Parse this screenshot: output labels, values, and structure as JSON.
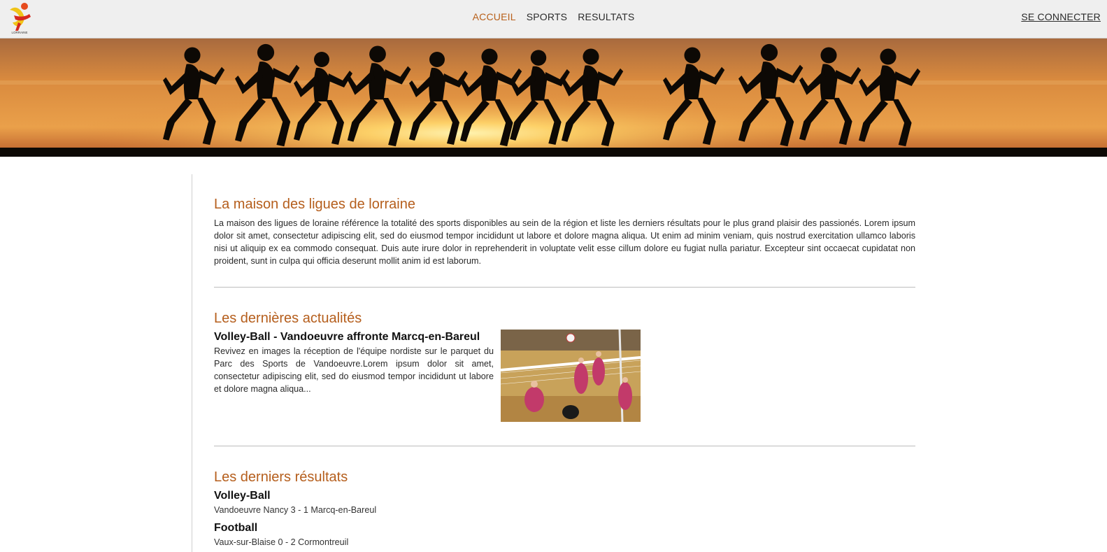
{
  "header": {
    "logo_caption": "LORRAINE",
    "nav": [
      {
        "label": "ACCUEIL",
        "active": true
      },
      {
        "label": "SPORTS",
        "active": false
      },
      {
        "label": "RESULTATS",
        "active": false
      }
    ],
    "login_label": "SE CONNECTER"
  },
  "colors": {
    "accent": "#b55e1c",
    "nav_bg": "#efefef",
    "banner_sky_top": "#c87a3a",
    "banner_sky_glow": "#f2b451"
  },
  "intro": {
    "title": "La maison des ligues de lorraine",
    "text": "La maison des ligues de loraine référence la totalité des sports disponibles au sein de la région et liste les derniers résultats pour le plus grand plaisir des passionés. Lorem ipsum dolor sit amet, consectetur adipiscing elit, sed do eiusmod tempor incididunt ut labore et dolore magna aliqua. Ut enim ad minim veniam, quis nostrud exercitation ullamco laboris nisi ut aliquip ex ea commodo consequat. Duis aute irure dolor in reprehenderit in voluptate velit esse cillum dolore eu fugiat nulla pariatur. Excepteur sint occaecat cupidatat non proident, sunt in culpa qui officia deserunt mollit anim id est laborum."
  },
  "news": {
    "title": "Les dernières actualités",
    "items": [
      {
        "headline": "Volley-Ball - Vandoeuvre affronte Marcq-en-Bareul",
        "excerpt": "Revivez en images la réception de l'équipe nordiste sur le parquet du Parc des Sports de Vandoeuvre.Lorem ipsum dolor sit amet, consectetur adipiscing elit, sed do eiusmod tempor incididunt ut labore et dolore magna aliqua...",
        "image": "volleyball-photo"
      }
    ]
  },
  "results": {
    "title": "Les derniers résultats",
    "items": [
      {
        "sport": "Volley-Ball",
        "score": "Vandoeuvre Nancy 3 - 1 Marcq-en-Bareul"
      },
      {
        "sport": "Football",
        "score": "Vaux-sur-Blaise 0 - 2 Cormontreuil"
      }
    ]
  }
}
